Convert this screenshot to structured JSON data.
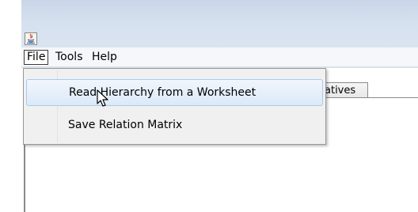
{
  "window": {
    "icon": "java-icon"
  },
  "menubar": {
    "items": [
      {
        "label": "File"
      },
      {
        "label": "Tools"
      },
      {
        "label": "Help"
      }
    ]
  },
  "file_menu": {
    "items": [
      {
        "label": "Read Hierarchy from a Worksheet"
      },
      {
        "label": "Save Relation Matrix"
      }
    ]
  },
  "tab": {
    "label": "atives"
  },
  "cursor": "arrow-cursor-icon"
}
